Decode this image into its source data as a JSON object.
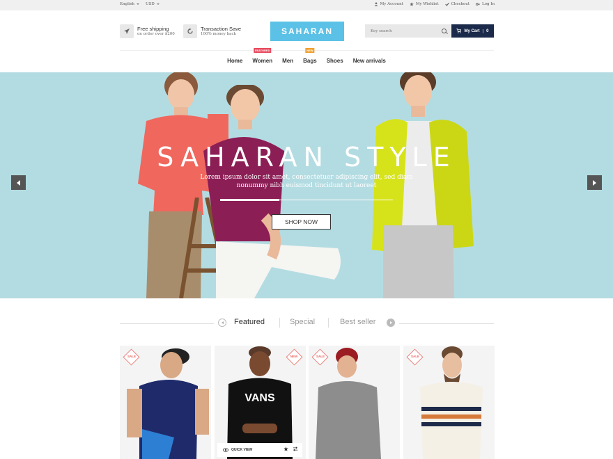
{
  "topbar": {
    "language": "English",
    "currency": "USD",
    "links": [
      {
        "label": "My Account",
        "icon": "user-icon"
      },
      {
        "label": "My Wishlist",
        "icon": "star-icon"
      },
      {
        "label": "Checkout",
        "icon": "check-icon"
      },
      {
        "label": "Log In",
        "icon": "key-icon"
      }
    ]
  },
  "header": {
    "features": [
      {
        "title": "Free shipping",
        "subtitle": "on order over $200",
        "icon": "plane-icon"
      },
      {
        "title": "Transaction Save",
        "subtitle": "100% money back",
        "icon": "refresh-icon"
      }
    ],
    "logo": "SAHARAN",
    "search_placeholder": "Key search",
    "cart_label": "My Cart",
    "cart_count": "0"
  },
  "nav": {
    "items": [
      {
        "label": "Home",
        "badge": ""
      },
      {
        "label": "Women",
        "badge": "FEATURED"
      },
      {
        "label": "Men",
        "badge": ""
      },
      {
        "label": "Bags",
        "badge": "NEW"
      },
      {
        "label": "Shoes",
        "badge": ""
      },
      {
        "label": "New arrivals",
        "badge": ""
      }
    ]
  },
  "hero": {
    "title": "SAHARAN STYLE",
    "subtitle": "Lorem ipsum dolor sit amet, consectetuer adipiscing elit, sed diam nonummy nibh euismod tincidunt ut laoreet",
    "button": "SHOP NOW",
    "background_color": "#b3dce2"
  },
  "tabs": {
    "items": [
      "Featured",
      "Special",
      "Best seller"
    ],
    "active": "Featured"
  },
  "products": [
    {
      "badge": "SALE",
      "badge_side": "left",
      "shirt_color": "#1f2a6b"
    },
    {
      "badge": "NEW",
      "badge_side": "right",
      "shirt_color": "#111111",
      "shirt_text": "VANS",
      "quick_view": "QUICK VIEW"
    },
    {
      "badge": "SALE",
      "badge_side": "left",
      "shirt_color": "#8d8d8d"
    },
    {
      "badge": "SALE",
      "badge_side": "left",
      "shirt_color": "#f5f0e6"
    }
  ]
}
